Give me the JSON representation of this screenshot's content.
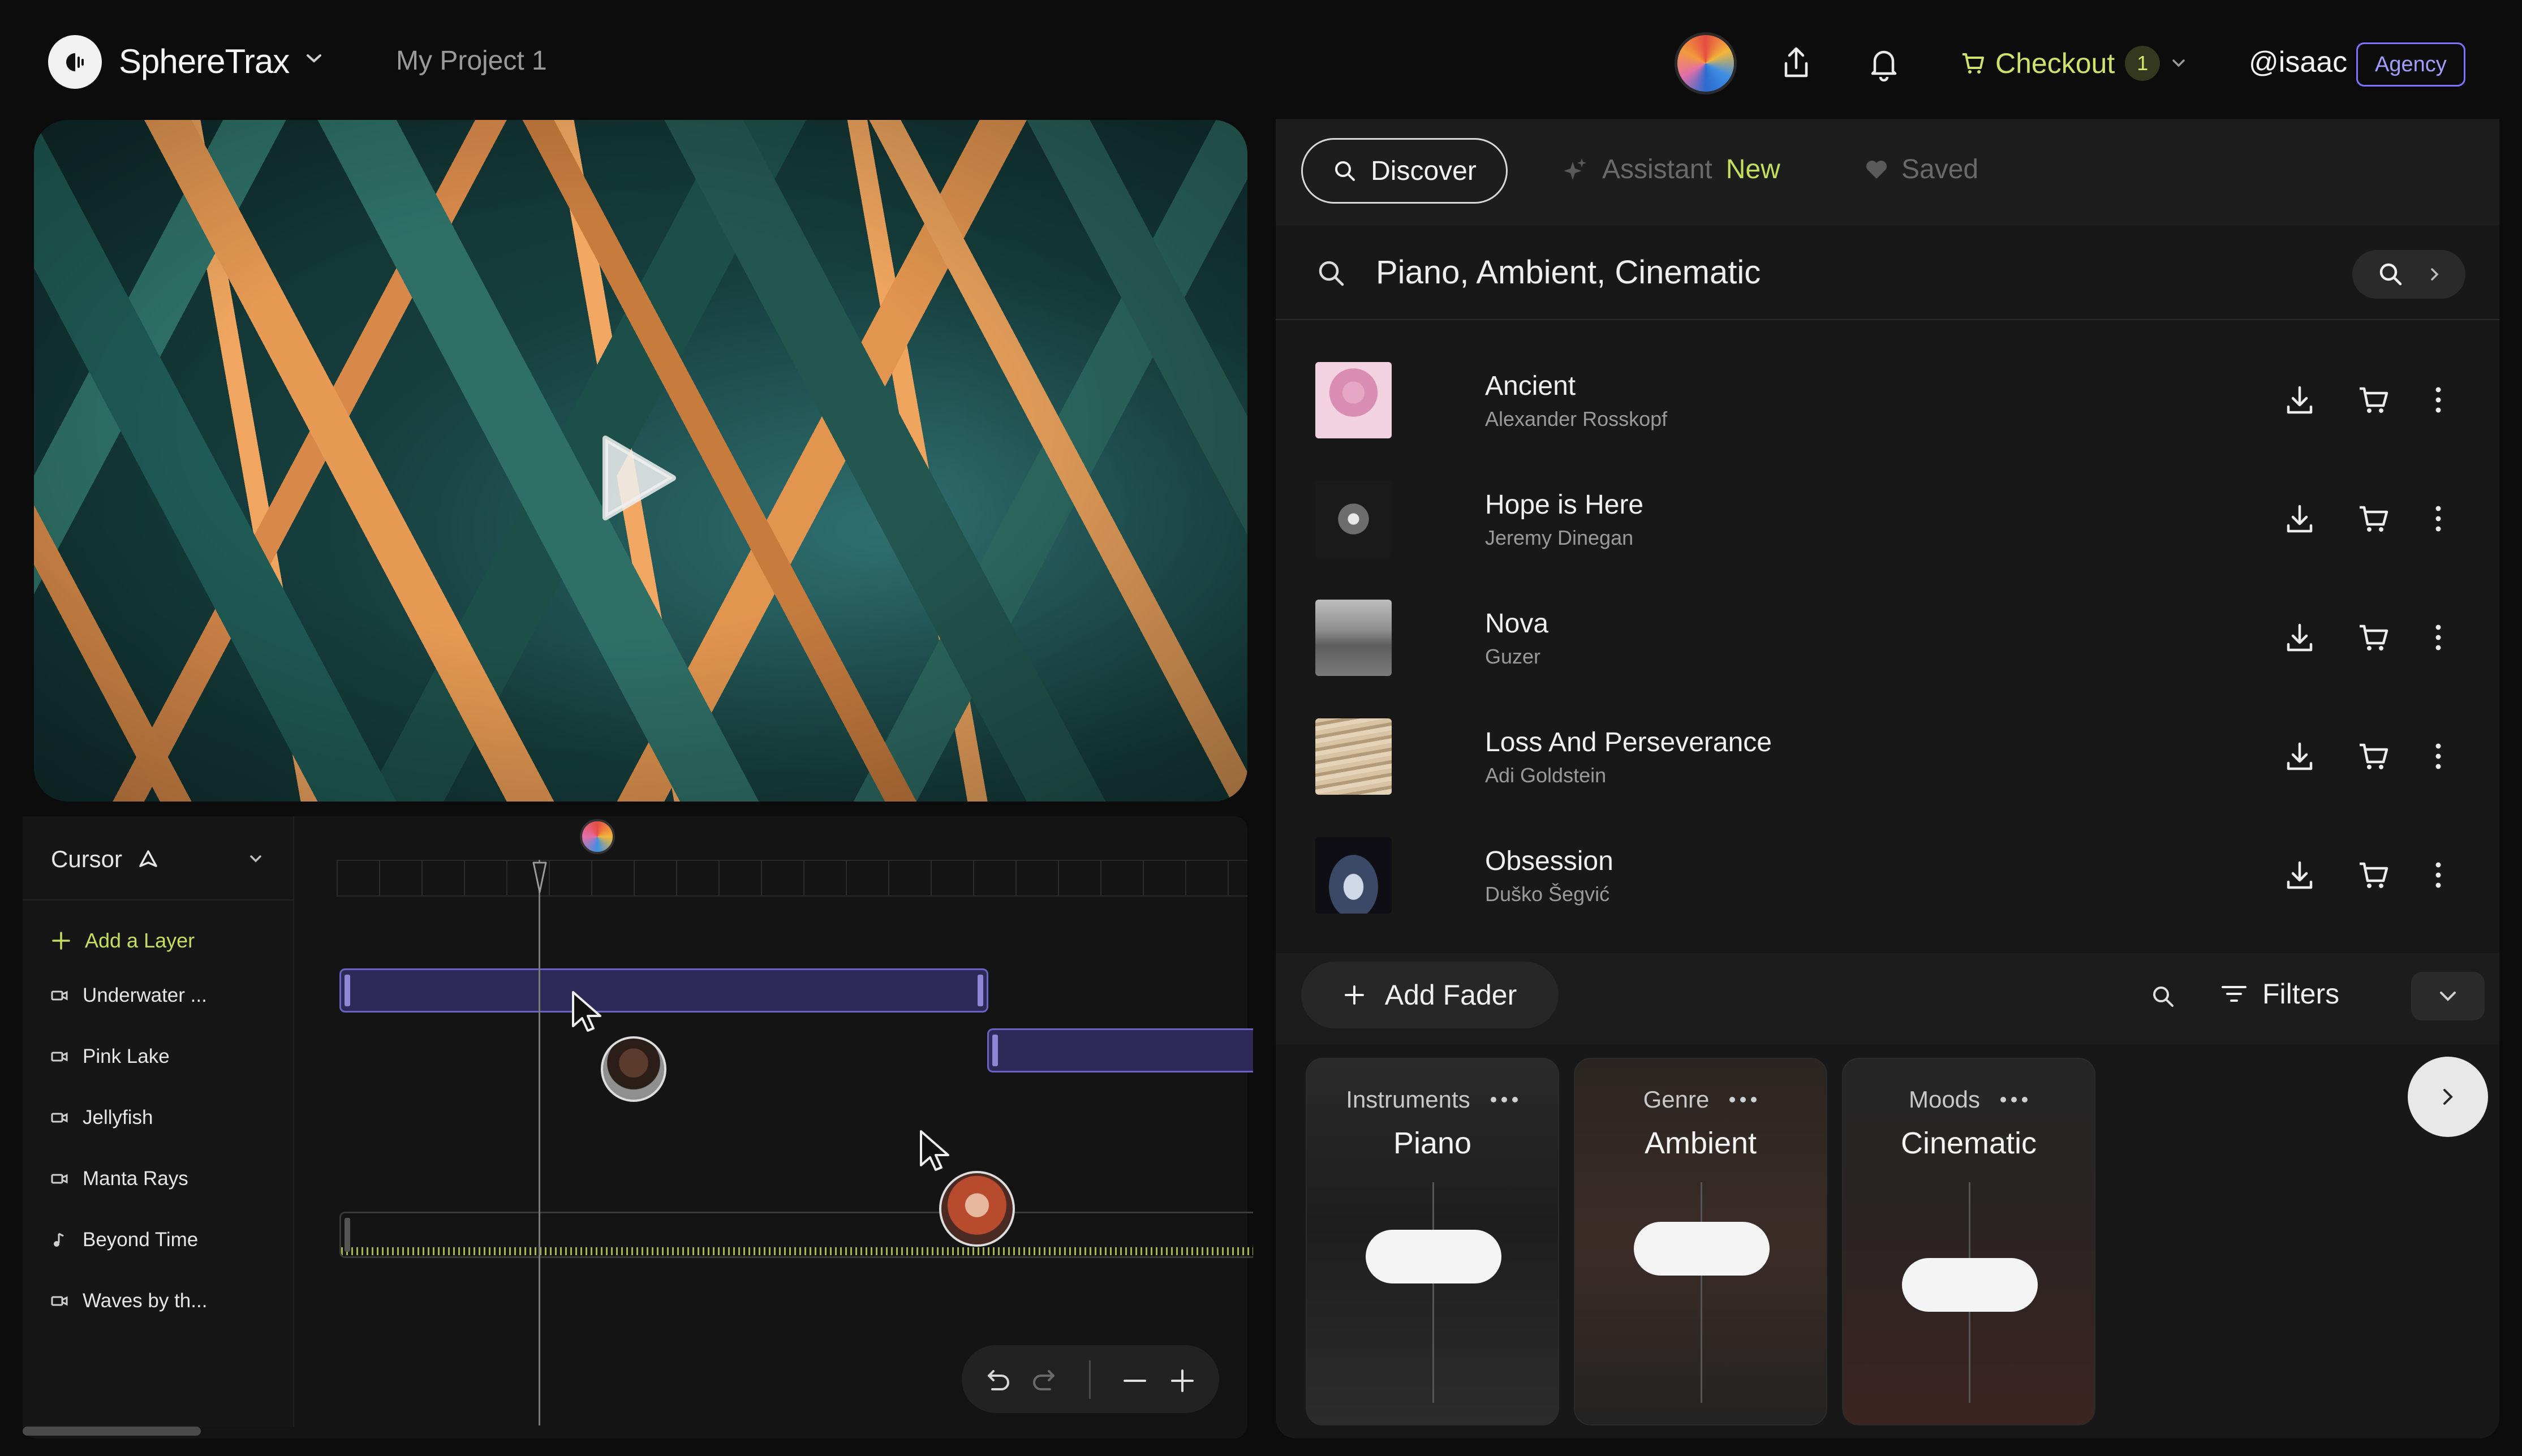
{
  "app": {
    "brand": "SphereTrax",
    "project": "My Project 1",
    "checkout_label": "Checkout",
    "cart_count": "1",
    "user_handle": "@isaac",
    "plan_badge": "Agency"
  },
  "timeline": {
    "mode_label": "Cursor",
    "add_layer_label": "Add a Layer",
    "layers": [
      {
        "label": "Underwater ...",
        "icon": "video-icon"
      },
      {
        "label": "Pink Lake",
        "icon": "video-icon"
      },
      {
        "label": "Jellyfish",
        "icon": "video-icon"
      },
      {
        "label": "Manta Rays",
        "icon": "video-icon"
      },
      {
        "label": "Beyond Time",
        "icon": "music-note-icon"
      },
      {
        "label": "Waves by th...",
        "icon": "video-icon"
      }
    ]
  },
  "tabs": {
    "discover": "Discover",
    "assistant": "Assistant",
    "assistant_badge": "New",
    "saved": "Saved"
  },
  "search": {
    "query": "Piano, Ambient, Cinematic"
  },
  "tracks": [
    {
      "title": "Ancient",
      "artist": "Alexander Rosskopf"
    },
    {
      "title": "Hope is Here",
      "artist": "Jeremy Dinegan"
    },
    {
      "title": "Nova",
      "artist": "Guzer"
    },
    {
      "title": "Loss And Perseverance",
      "artist": "Adi Goldstein"
    },
    {
      "title": "Obsession",
      "artist": "Duško Šegvić"
    }
  ],
  "faders": {
    "add_label": "Add Fader",
    "filters_label": "Filters",
    "cards": [
      {
        "category": "Instruments",
        "value": "Piano"
      },
      {
        "category": "Genre",
        "value": "Ambient"
      },
      {
        "category": "Moods",
        "value": "Cinematic"
      }
    ]
  },
  "colors": {
    "accent_green": "#c6de5d",
    "accent_purple": "#7e73ff",
    "clip_fill": "#2d2a58"
  }
}
